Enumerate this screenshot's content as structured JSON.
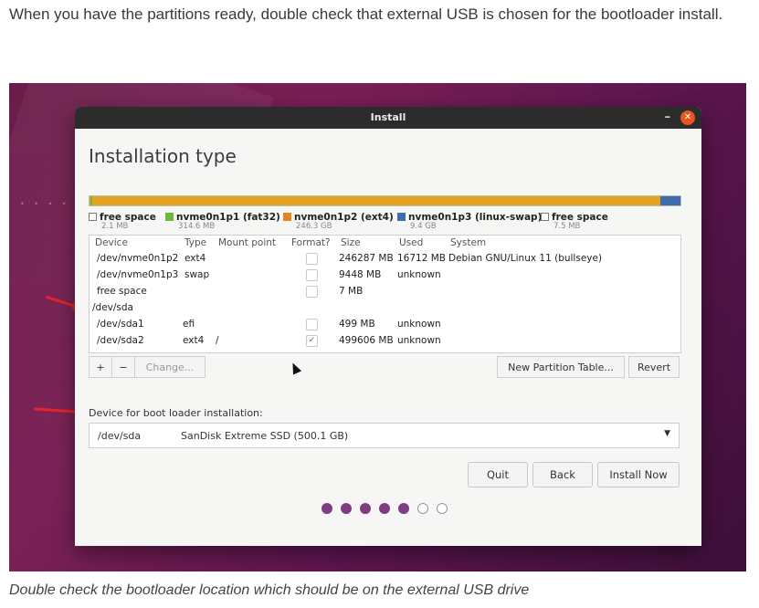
{
  "intro_text": "When you have the partitions ready, double check that external USB is chosen for the bootloader install.",
  "caption": "Double check the bootloader location which should be on the external USB drive",
  "window": {
    "title": "Install",
    "minimize": "–",
    "close": "✕"
  },
  "heading": "Installation type",
  "legend": [
    {
      "name": "free space",
      "size": "2.1 MB",
      "color": "#ffffff"
    },
    {
      "name": "nvme0n1p1 (fat32)",
      "size": "314.6 MB",
      "color": "#69b93c"
    },
    {
      "name": "nvme0n1p2 (ext4)",
      "size": "246.3 GB",
      "color": "#e5851f"
    },
    {
      "name": "nvme0n1p3 (linux-swap)",
      "size": "9.4 GB",
      "color": "#3c6db0"
    },
    {
      "name": "free space",
      "size": "7.5 MB",
      "color": "#ffffff"
    }
  ],
  "table": {
    "headers": [
      "Device",
      "Type",
      "Mount point",
      "Format?",
      "Size",
      "Used",
      "System"
    ],
    "rows": [
      {
        "device": "/dev/nvme0n1p2",
        "type": "ext4",
        "mount": "",
        "format": false,
        "size": "246287 MB",
        "used": "16712 MB",
        "system": "Debian GNU/Linux 11 (bullseye)"
      },
      {
        "device": "/dev/nvme0n1p3",
        "type": "swap",
        "mount": "",
        "format": false,
        "size": "9448 MB",
        "used": "unknown",
        "system": ""
      },
      {
        "device": "free space",
        "type": "",
        "mount": "",
        "format": false,
        "size": "7 MB",
        "used": "",
        "system": ""
      },
      {
        "device": "/dev/sda",
        "type": "",
        "mount": "",
        "format": null,
        "size": "",
        "used": "",
        "system": ""
      },
      {
        "device": "/dev/sda1",
        "type": "efi",
        "mount": "",
        "format": false,
        "size": "499 MB",
        "used": "unknown",
        "system": ""
      },
      {
        "device": "/dev/sda2",
        "type": "ext4",
        "mount": "/",
        "format": true,
        "size": "499606 MB",
        "used": "unknown",
        "system": ""
      }
    ]
  },
  "toolbar": {
    "add": "+",
    "remove": "−",
    "change": "Change...",
    "new_table": "New Partition Table...",
    "revert": "Revert"
  },
  "bootloader": {
    "label": "Device for boot loader installation:",
    "device": "/dev/sda",
    "description": "SanDisk Extreme SSD (500.1 GB)",
    "arrow": "▼"
  },
  "buttons": {
    "quit": "Quit",
    "back": "Back",
    "install": "Install Now"
  },
  "progress": {
    "steps": 7,
    "completed": 5
  },
  "checkmark": "✓"
}
